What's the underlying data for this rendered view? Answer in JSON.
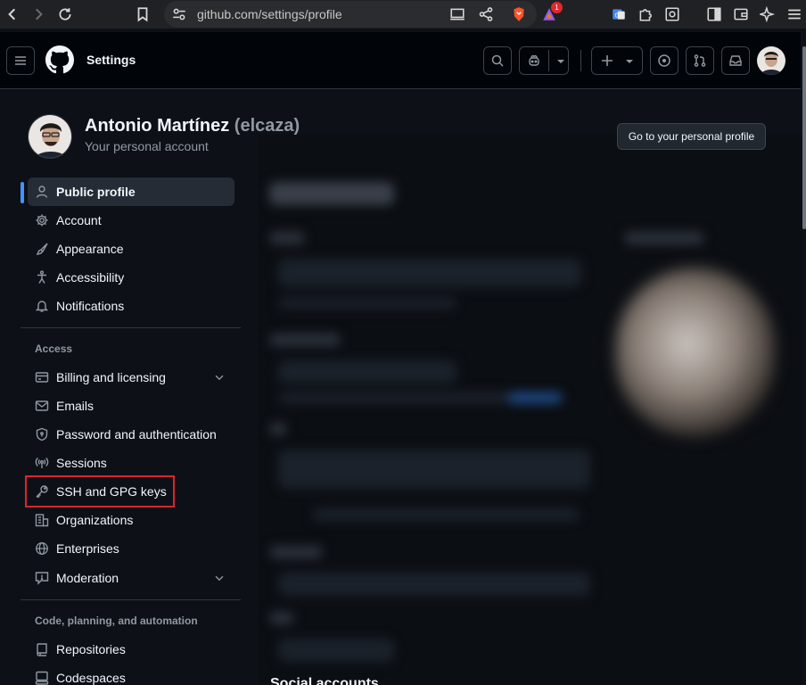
{
  "browser": {
    "url": "github.com/settings/profile",
    "notification_count": "1"
  },
  "header": {
    "title": "Settings"
  },
  "profile": {
    "name": "Antonio Martínez",
    "login": "(elcaza)",
    "subtitle": "Your personal account",
    "go_to_profile_label": "Go to your personal profile"
  },
  "sidebar": {
    "top_items": [
      {
        "label": "Public profile",
        "icon": "person-icon",
        "active": true
      },
      {
        "label": "Account",
        "icon": "gear-icon"
      },
      {
        "label": "Appearance",
        "icon": "paintbrush-icon"
      },
      {
        "label": "Accessibility",
        "icon": "accessibility-icon"
      },
      {
        "label": "Notifications",
        "icon": "bell-icon"
      }
    ],
    "access_heading": "Access",
    "access_items": [
      {
        "label": "Billing and licensing",
        "icon": "credit-card-icon",
        "expandable": true
      },
      {
        "label": "Emails",
        "icon": "mail-icon"
      },
      {
        "label": "Password and authentication",
        "icon": "shield-lock-icon"
      },
      {
        "label": "Sessions",
        "icon": "broadcast-icon"
      },
      {
        "label": "SSH and GPG keys",
        "icon": "key-icon",
        "highlighted": true
      },
      {
        "label": "Organizations",
        "icon": "organization-icon"
      },
      {
        "label": "Enterprises",
        "icon": "globe-icon"
      },
      {
        "label": "Moderation",
        "icon": "report-icon",
        "expandable": true
      }
    ],
    "code_heading": "Code, planning, and automation",
    "code_items": [
      {
        "label": "Repositories",
        "icon": "repo-icon"
      },
      {
        "label": "Codespaces",
        "icon": "codespaces-icon"
      }
    ]
  },
  "main": {
    "social_heading": "Social accounts"
  },
  "colors": {
    "accent": "#4493f8",
    "highlight_border": "#d7262b",
    "background": "#0d1117"
  }
}
